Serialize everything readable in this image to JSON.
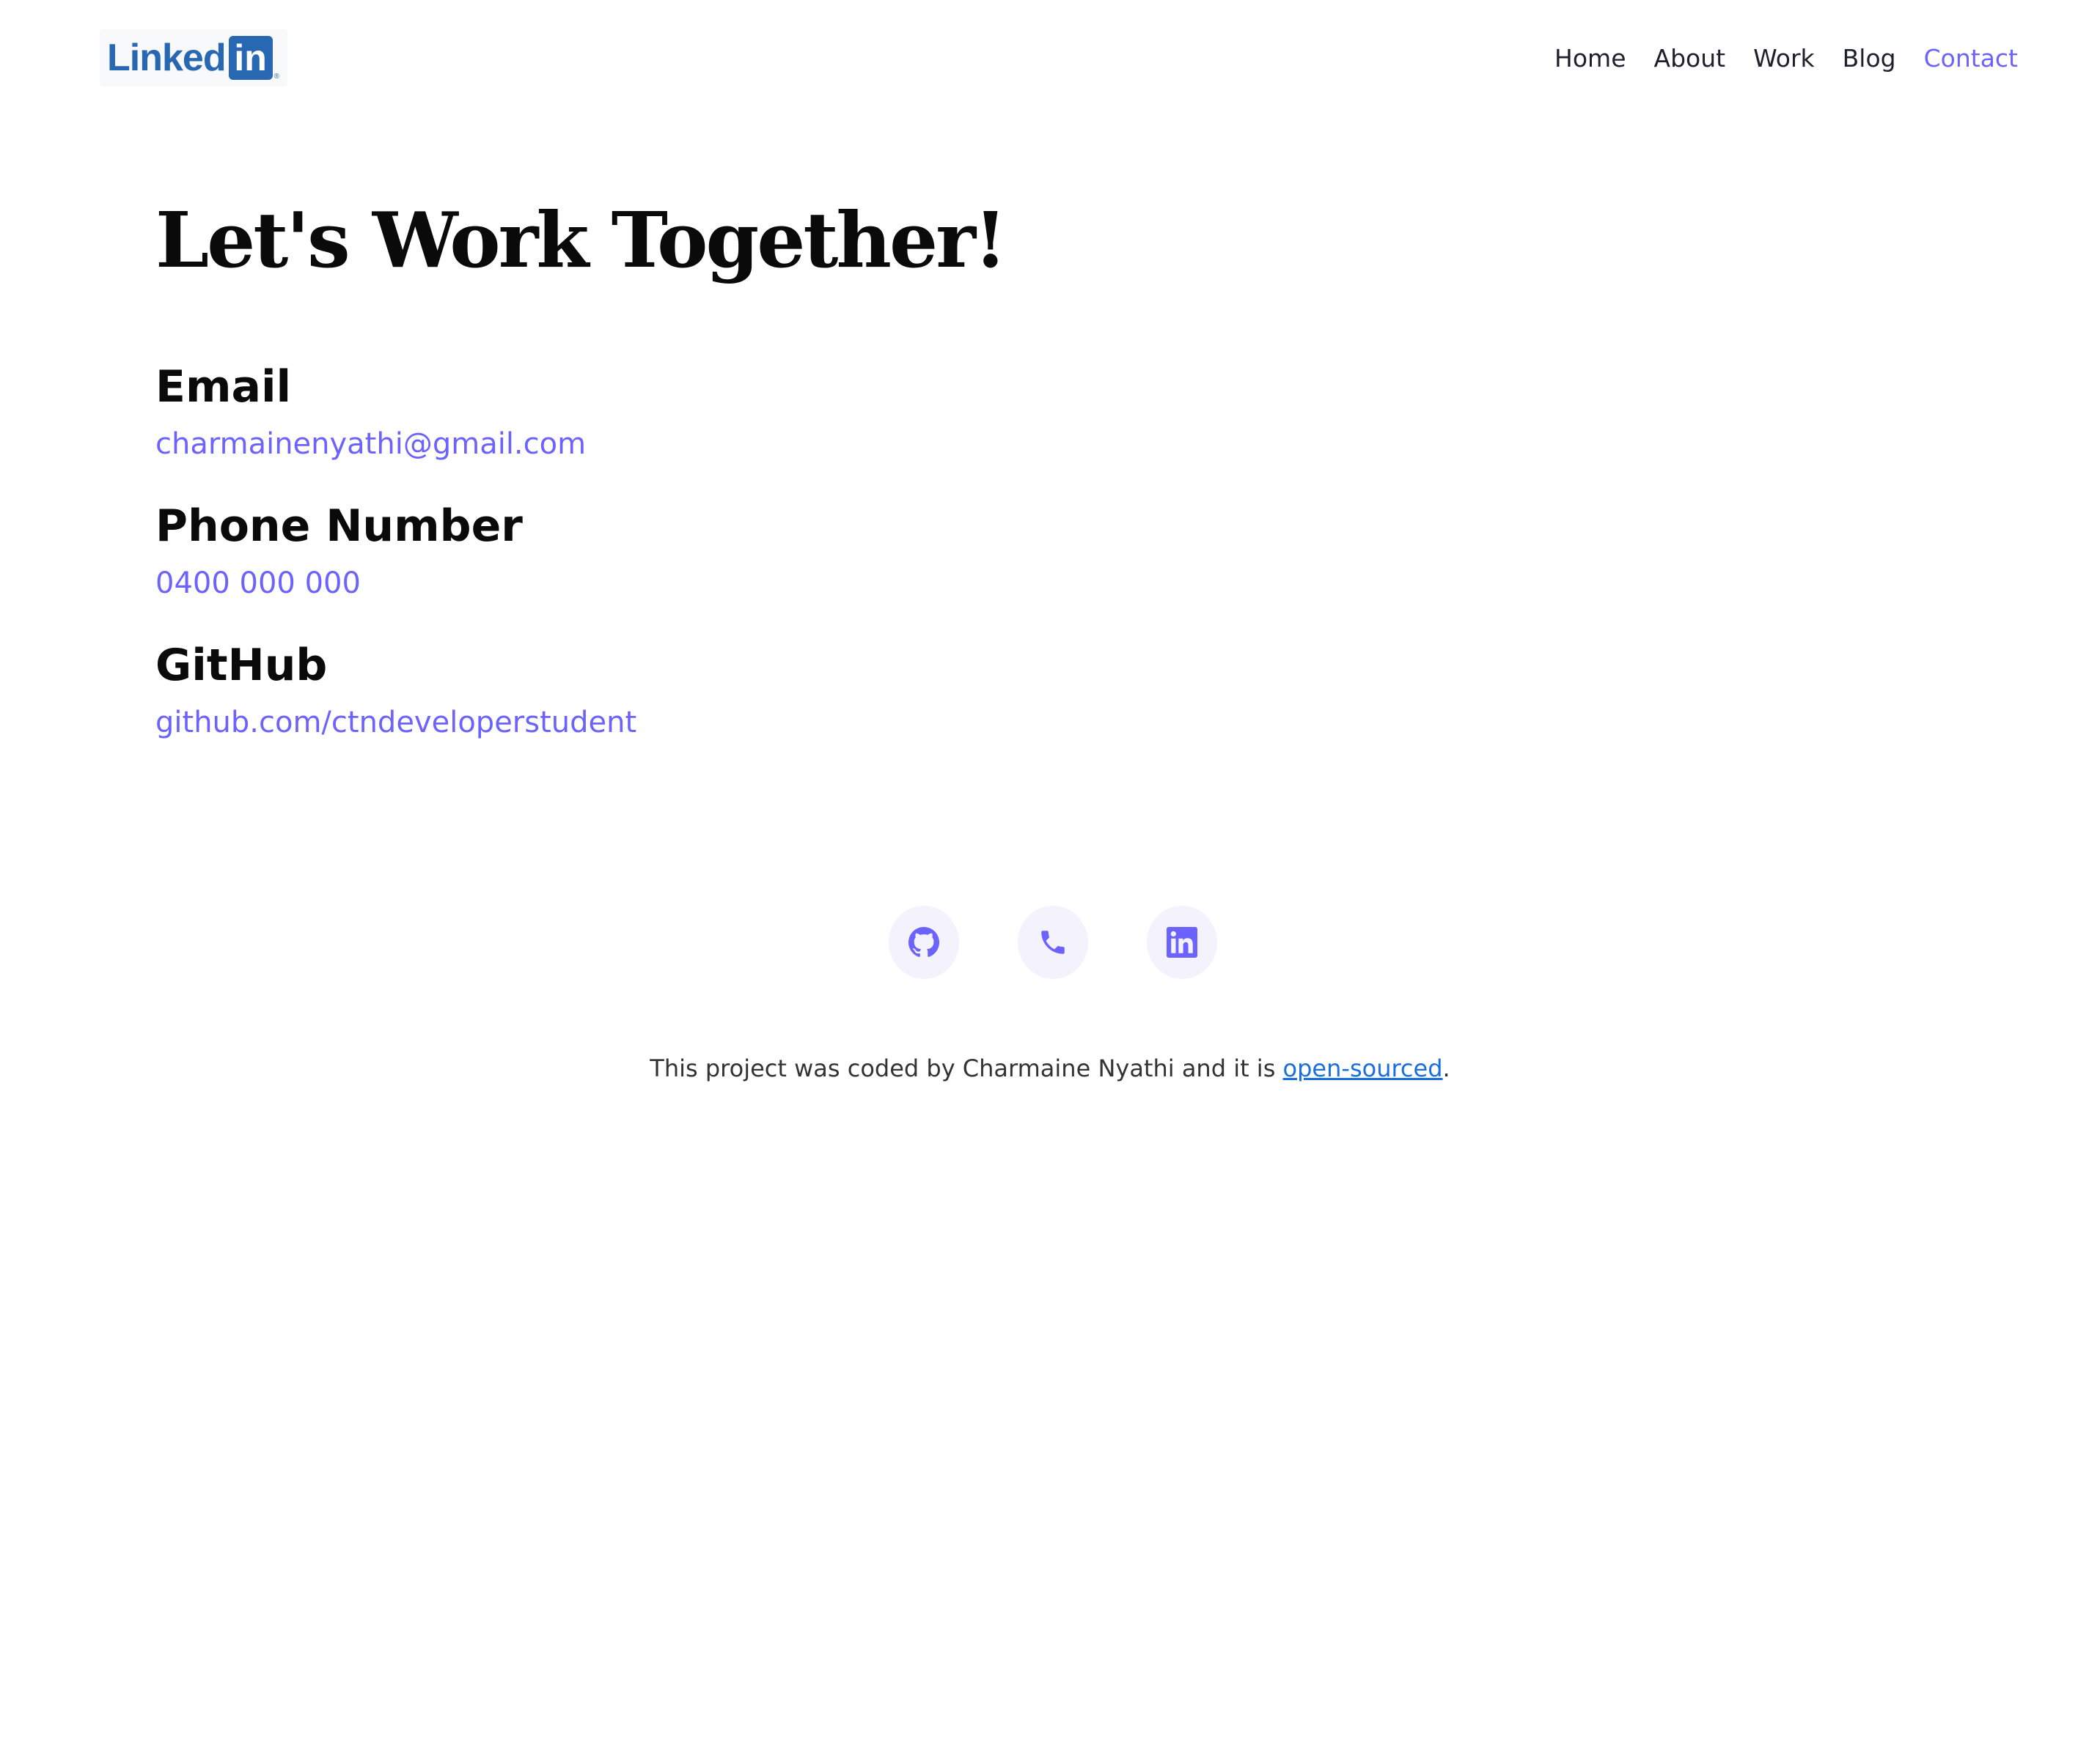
{
  "header": {
    "logo": {
      "word": "Linked",
      "box": "in",
      "registered": "®"
    },
    "nav": [
      {
        "label": "Home",
        "active": false
      },
      {
        "label": "About",
        "active": false
      },
      {
        "label": "Work",
        "active": false
      },
      {
        "label": "Blog",
        "active": false
      },
      {
        "label": "Contact",
        "active": true
      }
    ]
  },
  "main": {
    "title": "Let's Work Together!",
    "sections": [
      {
        "heading": "Email",
        "value": "charmainenyathi@gmail.com"
      },
      {
        "heading": "Phone Number",
        "value": "0400 000 000"
      },
      {
        "heading": "GitHub",
        "value": "github.com/ctndeveloperstudent"
      }
    ]
  },
  "social": {
    "icons": [
      "github-icon",
      "phone-icon",
      "linkedin-icon"
    ]
  },
  "footer": {
    "text_before": "This project was coded by Charmaine Nyathi and it is ",
    "link_text": "open-sourced",
    "text_after": "."
  },
  "colors": {
    "accent": "#6c63ff",
    "link": "#1a6fe0",
    "brand_linkedin": "#2867b2"
  }
}
